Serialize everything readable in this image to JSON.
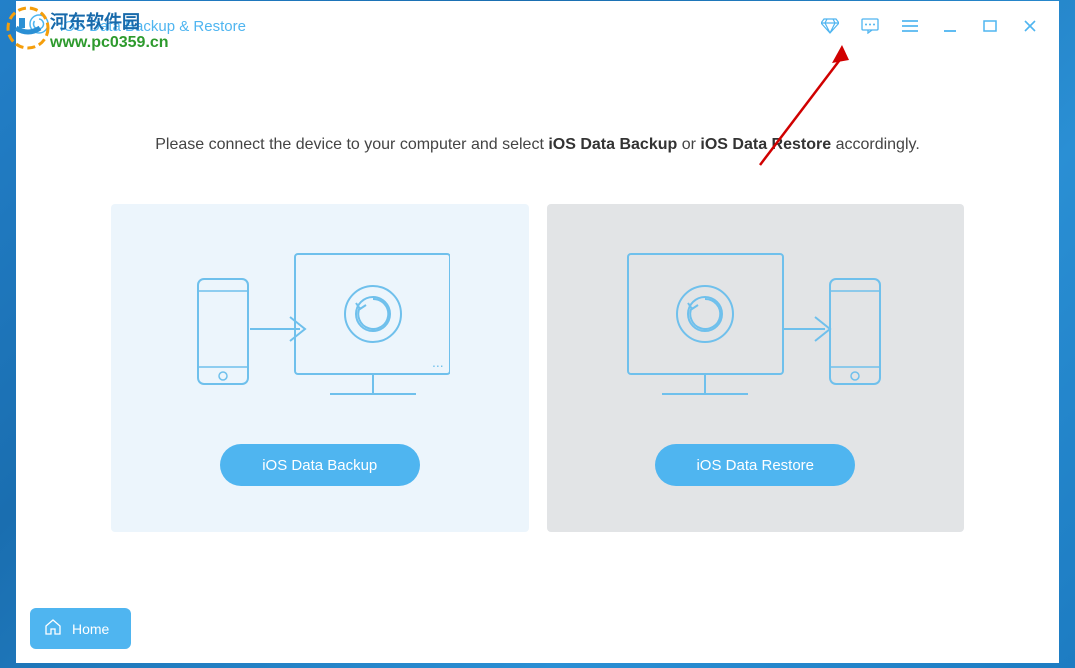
{
  "app": {
    "title": "iOS Data Backup & Restore"
  },
  "instruction": {
    "prefix": "Please connect the device to your computer and select ",
    "strong1": "iOS Data Backup",
    "middle": " or ",
    "strong2": "iOS Data Restore",
    "suffix": " accordingly."
  },
  "buttons": {
    "backup": "iOS Data Backup",
    "restore": "iOS Data Restore",
    "home": "Home"
  },
  "watermark": {
    "line1": "河东软件园",
    "line2": "www.pc0359.cn"
  }
}
